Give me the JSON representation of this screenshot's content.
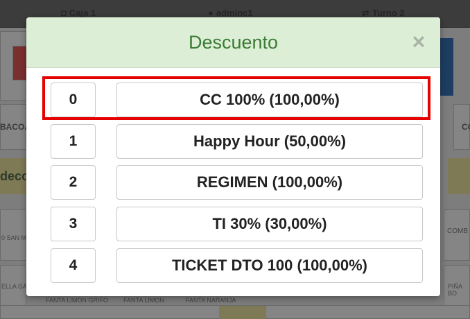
{
  "background": {
    "topbar": {
      "caja": "Caja 1",
      "user": "adminc1",
      "turno": "Turno 2"
    },
    "left_fragments": [
      "BACOA",
      "deco",
      "0 SAN M",
      "ELLA GA"
    ],
    "right_fragments": [
      "CC",
      "COMB",
      "PIÑA BO"
    ],
    "bottom_products": [
      "FANTA LIMON GRIFO",
      "FANTA LIMON",
      "FANTA NARANJA"
    ]
  },
  "modal": {
    "title": "Descuento",
    "close_glyph": "×",
    "options": [
      {
        "number": "0",
        "label": "CC 100% (100,00%)"
      },
      {
        "number": "1",
        "label": "Happy Hour (50,00%)"
      },
      {
        "number": "2",
        "label": "REGIMEN (100,00%)"
      },
      {
        "number": "3",
        "label": "TI 30% (30,00%)"
      },
      {
        "number": "4",
        "label": "TICKET DTO 100 (100,00%)"
      }
    ]
  },
  "colors": {
    "header_bg": "#dcefd6",
    "title_green": "#3c7b36",
    "highlight_red": "#e60000"
  }
}
